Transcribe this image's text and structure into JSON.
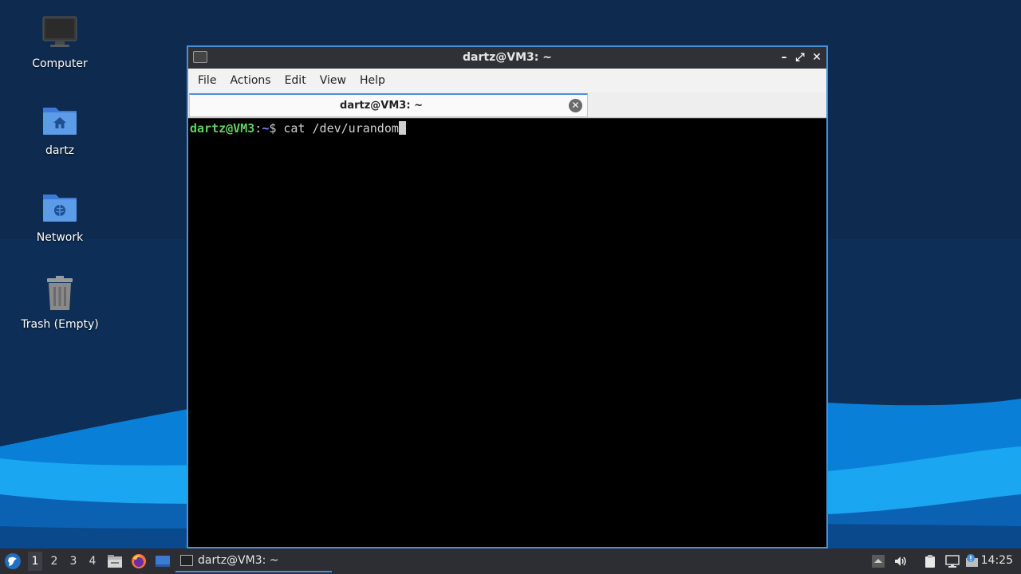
{
  "desktop": {
    "icons": [
      {
        "label": "Computer"
      },
      {
        "label": "dartz"
      },
      {
        "label": "Network"
      },
      {
        "label": "Trash (Empty)"
      }
    ]
  },
  "window": {
    "title": "dartz@VM3: ~",
    "menu": [
      "File",
      "Actions",
      "Edit",
      "View",
      "Help"
    ],
    "tab": {
      "label": "dartz@VM3: ~"
    }
  },
  "terminal": {
    "prompt_user": "dartz@VM3",
    "prompt_colon": ":",
    "prompt_path": "~",
    "prompt_symbol": "$ ",
    "command": "cat /dev/urandom"
  },
  "taskbar": {
    "workspaces": [
      "1",
      "2",
      "3",
      "4"
    ],
    "active_workspace": "1",
    "launchers": [
      "file-manager-icon",
      "firefox-icon",
      "desktop-icon"
    ],
    "tasks": [
      {
        "label": "dartz@VM3: ~"
      }
    ],
    "clock": "14:25"
  },
  "colors": {
    "accent": "#4a90d9",
    "prompt_user": "#5fd35f",
    "prompt_path": "#6f8cff",
    "terminal_bg": "#000000"
  }
}
